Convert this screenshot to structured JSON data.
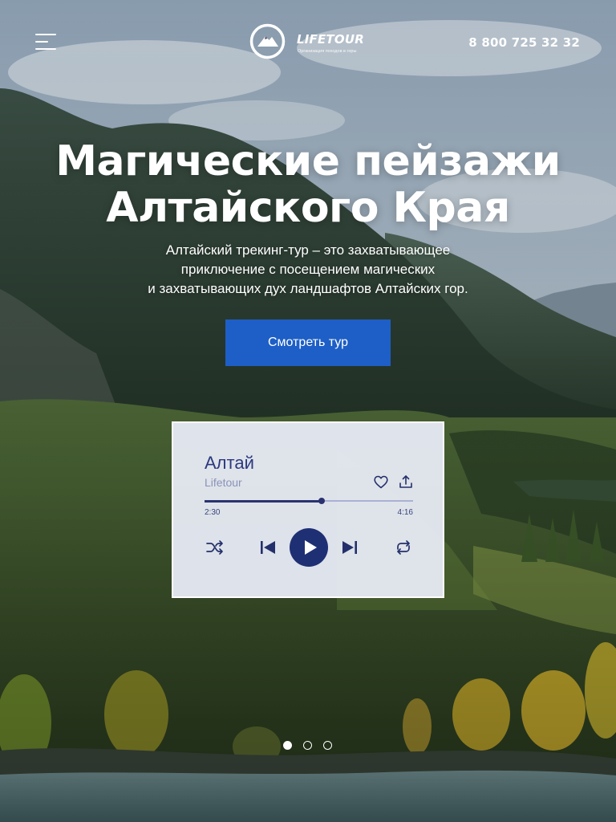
{
  "header": {
    "menu_icon": "hamburger-menu-icon",
    "logo": {
      "icon": "mountain-logo-icon",
      "name": "LIFETOUR",
      "tagline": "Организация походов в горы"
    },
    "phone": "8 800 725 32 32"
  },
  "hero": {
    "title_lines": [
      "Магические пейзажи",
      "Алтайского Края"
    ],
    "subtitle_lines": [
      "Алтайский трекинг-тур – это захватывающее",
      "приключение с посещением магических",
      "и захватывающих дух ландшафтов Алтайских гор."
    ],
    "cta_label": "Смотреть тур",
    "background": "altai-mountain-valley-river-photo"
  },
  "player": {
    "title": "Алтай",
    "artist": "Lifetour",
    "current_time": "2:30",
    "total_time": "4:16",
    "progress": 0.56,
    "icons": {
      "like": "heart-icon",
      "share": "share-icon",
      "shuffle": "shuffle-icon",
      "previous": "skip-previous-icon",
      "play": "play-icon",
      "next": "skip-next-icon",
      "repeat": "repeat-icon"
    }
  },
  "slider": {
    "count": 3,
    "active_index": 0
  },
  "colors": {
    "cta": "#1d5fc6",
    "player_background": "#e9ecf6",
    "player_accent": "#1f2f74",
    "player_title": "#2b3a7e"
  }
}
